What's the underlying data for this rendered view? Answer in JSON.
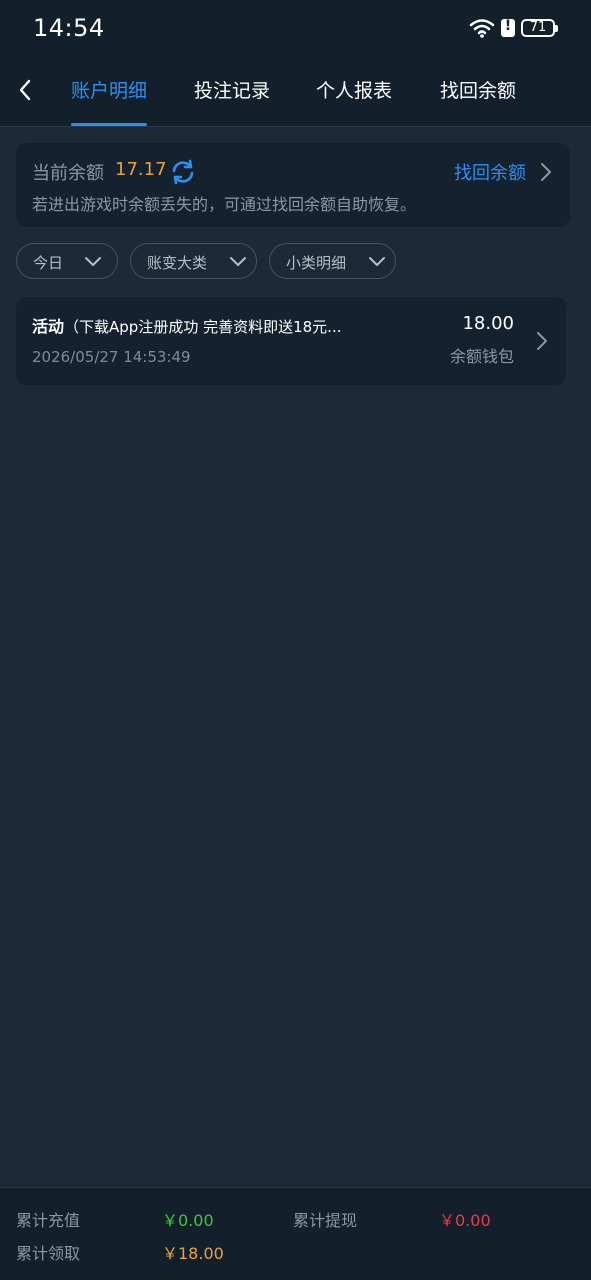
{
  "status_bar": {
    "time": "14:54",
    "battery": "71"
  },
  "tabs": [
    {
      "label": "账户明细",
      "active": true
    },
    {
      "label": "投注记录",
      "active": false
    },
    {
      "label": "个人报表",
      "active": false
    },
    {
      "label": "找回余额",
      "active": false
    }
  ],
  "balance": {
    "label": "当前余额",
    "value": "17.17",
    "recover_label": "找回余额",
    "hint": "若进出游戏时余额丢失的，可通过找回余额自助恢复。"
  },
  "filters": [
    {
      "label": "今日"
    },
    {
      "label": "账变大类"
    },
    {
      "label": "小类明细"
    }
  ],
  "records": [
    {
      "category": "活动",
      "description": "（下载App注册成功 完善资料即送18元...",
      "time": "2026/05/27 14:53:49",
      "amount": "18.00",
      "wallet": "余额钱包"
    }
  ],
  "summary": {
    "recharge_label": "累计充值",
    "recharge_value": "￥0.00",
    "withdraw_label": "累计提现",
    "withdraw_value": "￥0.00",
    "claim_label": "累计领取",
    "claim_value": "￥18.00"
  },
  "colors": {
    "accent": "#2f8ff0",
    "balance": "#e8a23a",
    "recharge": "#3cc83c",
    "withdraw": "#e83a4a",
    "claim": "#e8a23a"
  },
  "icons": {
    "back": "chevron-left-icon",
    "refresh": "refresh-icon",
    "chevron": "chevron-right-icon",
    "dropdown": "chevron-down-icon",
    "wifi": "wifi-icon",
    "alert": "alert-icon",
    "battery": "battery-icon"
  }
}
